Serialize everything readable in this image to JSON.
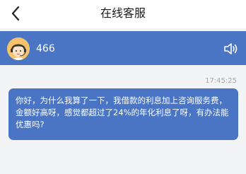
{
  "nav": {
    "title": "在线客服",
    "back_icon": "chevron-left-icon"
  },
  "agent": {
    "name": "466",
    "avatar_icon": "agent-avatar-icon",
    "speaker_icon": "speaker-icon"
  },
  "chat": {
    "messages": [
      {
        "time": "17:45:25",
        "text": "你好，为什么我算了一下，我借款的利息加上咨询服务费，金额好高呀，感觉都超过了24%的年化利息了呀，有办法能优惠吗?"
      }
    ]
  },
  "colors": {
    "brand": "#4a74c4",
    "chat_bg": "#f3f4f6",
    "timestamp": "#a4a8ae"
  }
}
